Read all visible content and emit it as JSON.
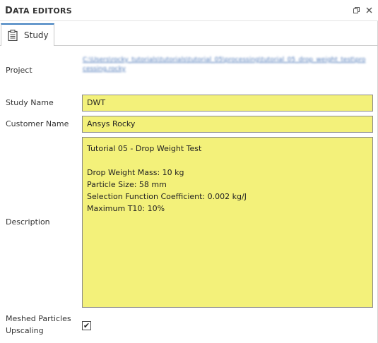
{
  "panel": {
    "title_first": "D",
    "title_rest": "ata Editors",
    "title_second_first": "E",
    "title_second_rest": "ditors"
  },
  "window_buttons": {
    "restore_icon": "restore-icon",
    "close_icon": "close-icon"
  },
  "tab": {
    "label": "Study",
    "icon": "clipboard-icon"
  },
  "fields": {
    "project_label": "Project",
    "project_value": "C:\\Users\\rocky_tutorials\\tutorials\\tutorial_05\\processing\\tutorial_05_drop_weight_test\\processing.rocky",
    "study_name_label": "Study Name",
    "study_name_value": "DWT",
    "customer_name_label": "Customer Name",
    "customer_name_value": "Ansys Rocky",
    "description_label": "Description",
    "description_value": "Tutorial 05 - Drop Weight Test\n\nDrop Weight Mass: 10 kg\nParticle Size: 58 mm\nSelection Function Coefficient: 0.002 kg/J\nMaximum T10: 10%",
    "meshed_label_line1": "Meshed Particles",
    "meshed_label_line2": "Upscaling",
    "meshed_checked": true,
    "check_mark": "✔"
  }
}
